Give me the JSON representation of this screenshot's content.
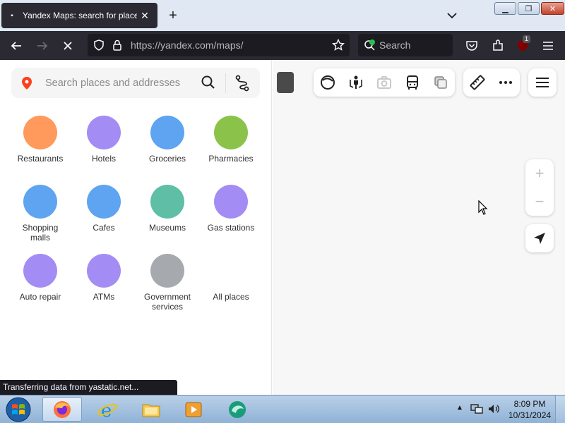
{
  "browser": {
    "tab_title": "Yandex Maps: search for places",
    "tab_favicon": "▪",
    "new_tab": "+",
    "url": "https://yandex.com/maps/",
    "search_placeholder": "Search",
    "extension_badge": "1",
    "status_text": "Transferring data from yastatic.net..."
  },
  "maps": {
    "search_placeholder": "Search places and addresses",
    "categories": [
      {
        "label": "Restaurants",
        "color": "#ff9a5c"
      },
      {
        "label": "Hotels",
        "color": "#a48cf5"
      },
      {
        "label": "Groceries",
        "color": "#5ea4f0"
      },
      {
        "label": "Pharmacies",
        "color": "#8bc34a"
      },
      {
        "label": "Shopping malls",
        "color": "#5ea4f0"
      },
      {
        "label": "Cafes",
        "color": "#5ea4f0"
      },
      {
        "label": "Museums",
        "color": "#5fbea6"
      },
      {
        "label": "Gas stations",
        "color": "#a48cf5"
      },
      {
        "label": "Auto repair",
        "color": "#a48cf5"
      },
      {
        "label": "ATMs",
        "color": "#a48cf5"
      },
      {
        "label": "Government services",
        "color": "#a6a9ad"
      },
      {
        "label": "All places",
        "color": ""
      }
    ],
    "zoom_in": "+",
    "zoom_out": "−"
  },
  "taskbar": {
    "time": "8:09 PM",
    "date": "10/31/2024"
  }
}
